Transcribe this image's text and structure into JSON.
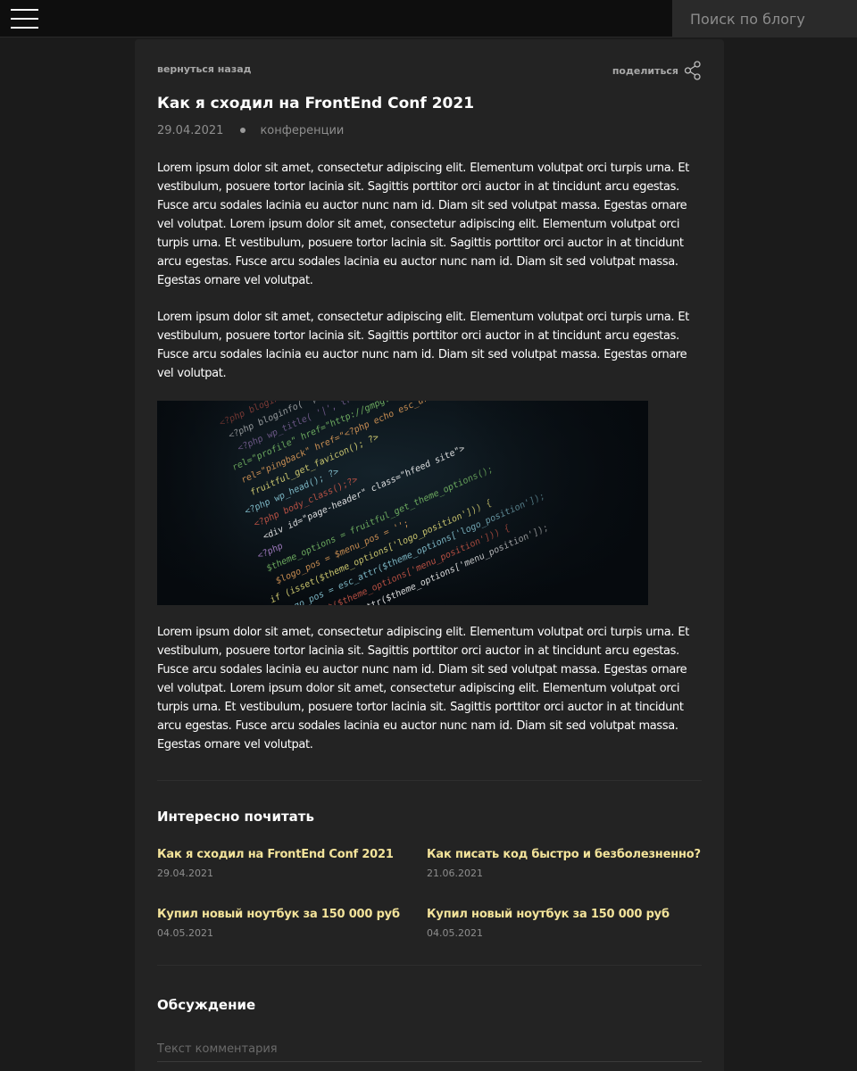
{
  "header": {
    "search_placeholder": "Поиск по блогу"
  },
  "post": {
    "back_label": "вернуться назад",
    "share_label": "поделиться",
    "title": "Как я сходил на FrontEnd Conf 2021",
    "date": "29.04.2021",
    "tag": "конференции",
    "paragraphs": [
      "Lorem ipsum dolor sit amet, consectetur adipiscing elit. Elementum volutpat orci turpis urna. Et vestibulum, posuere tortor lacinia sit. Sagittis porttitor orci auctor in at tincidunt arcu egestas. Fusce arcu sodales lacinia eu auctor nunc nam id. Diam sit sed volutpat massa. Egestas ornare vel volutpat. Lorem ipsum dolor sit amet, consectetur adipiscing elit. Elementum volutpat orci turpis urna. Et vestibulum, posuere tortor lacinia sit. Sagittis porttitor orci auctor in at tincidunt arcu egestas. Fusce arcu sodales lacinia eu auctor nunc nam id. Diam sit sed volutpat massa. Egestas ornare vel volutpat.",
      "Lorem ipsum dolor sit amet, consectetur adipiscing elit. Elementum volutpat orci turpis urna. Et vestibulum, posuere tortor lacinia sit. Sagittis porttitor orci auctor in at tincidunt arcu egestas. Fusce arcu sodales lacinia eu auctor nunc nam id. Diam sit sed volutpat massa. Egestas ornare vel volutpat.",
      "Lorem ipsum dolor sit amet, consectetur adipiscing elit. Elementum volutpat orci turpis urna. Et vestibulum, posuere tortor lacinia sit. Sagittis porttitor orci auctor in at tincidunt arcu egestas. Fusce arcu sodales lacinia eu auctor nunc nam id. Diam sit sed volutpat massa. Egestas ornare vel volutpat. Lorem ipsum dolor sit amet, consectetur adipiscing elit. Elementum volutpat orci turpis urna. Et vestibulum, posuere tortor lacinia sit. Sagittis porttitor orci auctor in at tincidunt arcu egestas. Fusce arcu sodales lacinia eu auctor nunc nam id. Diam sit sed volutpat massa. Egestas ornare vel volutpat."
    ],
    "image_code_lines": [
      "<?php bloginfo('name'); ?>",
      "<?php bloginfo( 'pingback_url' ); ?>",
      "<?php wp_title( '|', true, 'right' ); ?>",
      "rel=\"profile\" href=\"http://gmpg.org/xfn/11\"",
      "rel=\"pingback\" href=\"<?php echo esc_url",
      "fruitful_get_favicon(); ?>",
      "<?php wp_head(); ?>",
      "<?php body_class();?>",
      "<div id=\"page-header\" class=\"hfeed site\">",
      "<?php",
      "$theme_options = fruitful_get_theme_options();",
      "$logo_pos = $menu_pos = '';",
      "if (isset($theme_options['logo_position'])) {",
      "$logo_pos = esc_attr($theme_options['logo_position']);",
      "if (isset($theme_options['menu_position'])) {",
      "$menu_pos = esc_attr($theme_options['menu_position']);"
    ]
  },
  "related": {
    "heading": "Интересно почитать",
    "items": [
      {
        "title": "Как я сходил на FrontEnd Conf 2021",
        "date": "29.04.2021"
      },
      {
        "title": "Как писать код быстро и безболезненно?",
        "date": "21.06.2021"
      },
      {
        "title": "Купил новый ноутбук за 150 000 руб",
        "date": "04.05.2021"
      },
      {
        "title": "Купил новый ноутбук за 150 000 руб",
        "date": "04.05.2021"
      }
    ]
  },
  "discussion": {
    "heading": "Обсуждение",
    "comment_placeholder": "Текст комментария"
  },
  "colors": {
    "background": "#1b1b1b",
    "card": "#232323",
    "topbar": "#0e0e0e",
    "accent_link": "#f3e39a",
    "muted_text": "#8e8e8e"
  },
  "icons": {
    "menu": "hamburger-menu-icon",
    "share": "share-icon"
  }
}
